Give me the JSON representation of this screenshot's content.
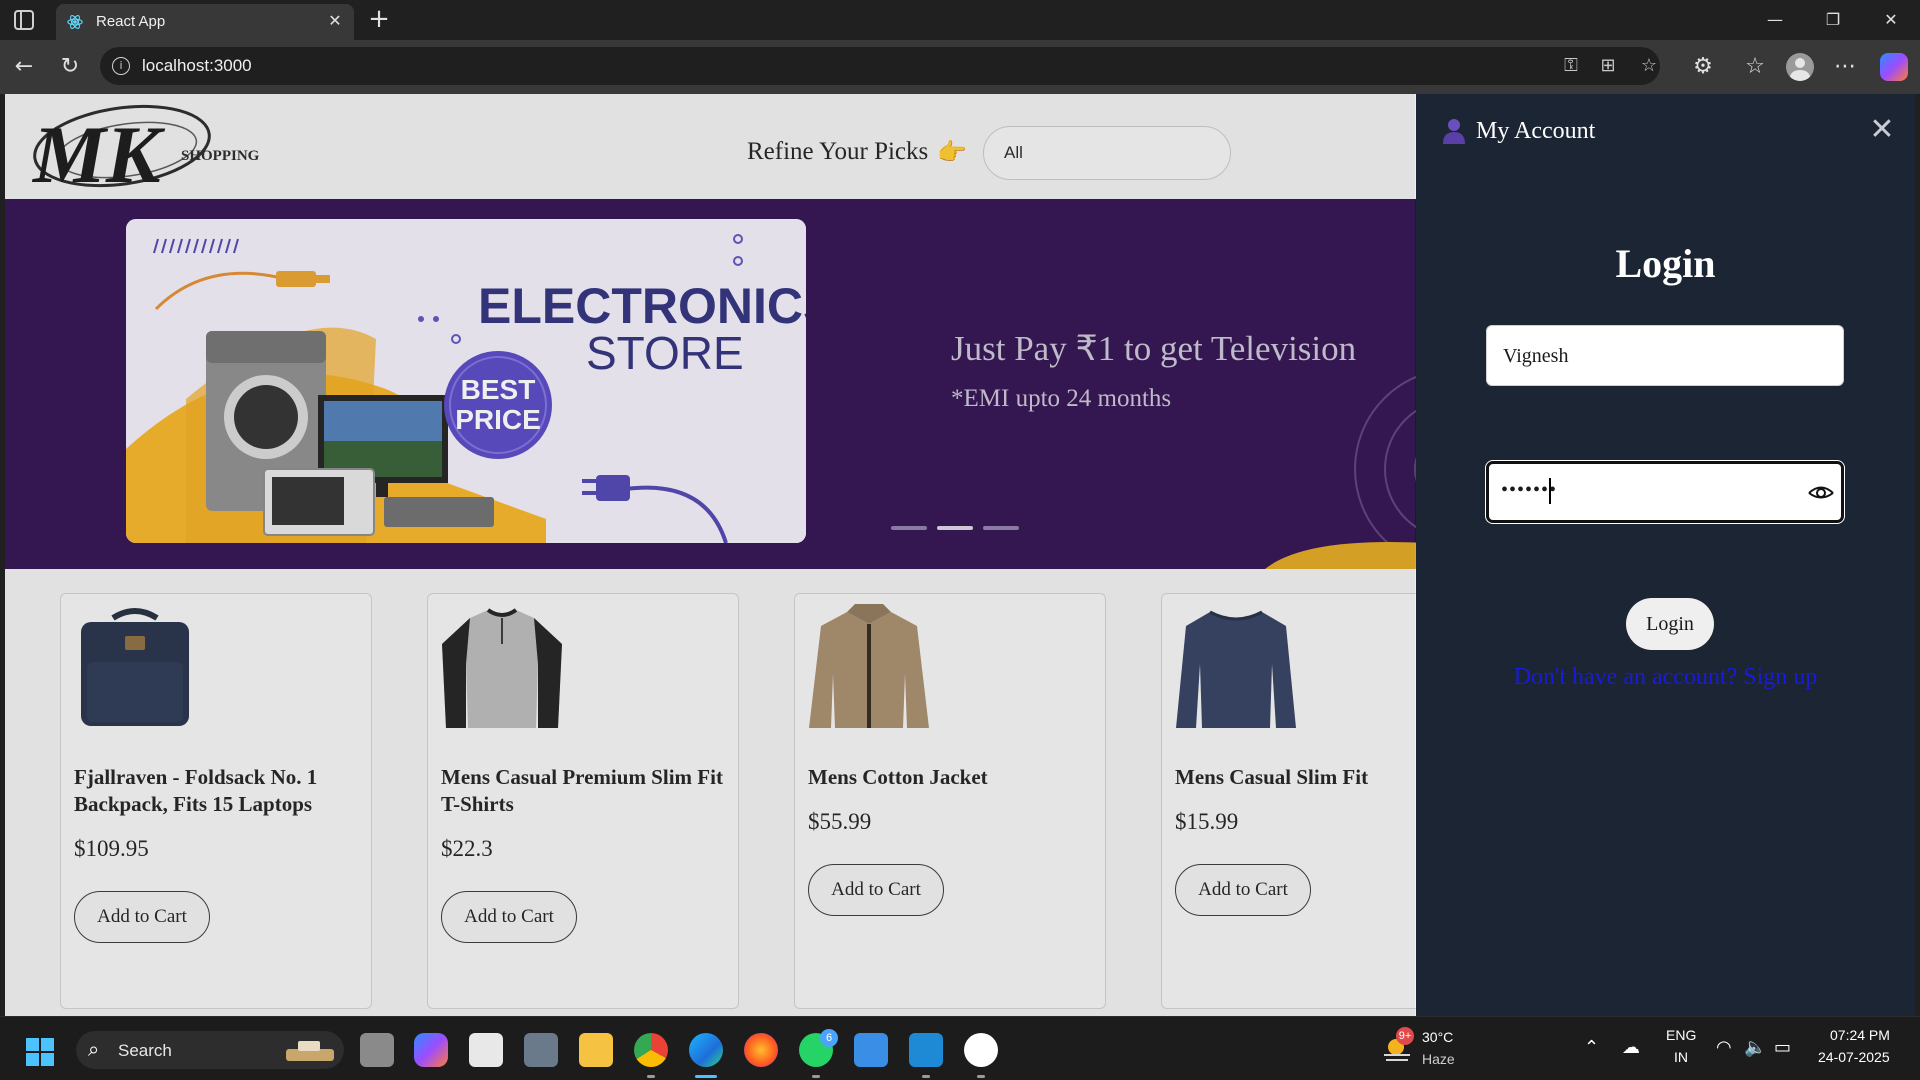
{
  "browser": {
    "tab_title": "React App",
    "url": "localhost:3000"
  },
  "header": {
    "logo_text": "MK",
    "logo_subtext": "SHOPPING",
    "refine_label": "Refine Your Picks",
    "refine_emoji": "👉",
    "filter_value": "All"
  },
  "banner": {
    "image_title_1": "ELECTRONICS",
    "image_title_2": "STORE",
    "badge_1": "BEST",
    "badge_2": "PRICE",
    "headline": "Just Pay ₹1 to get Television",
    "subline": "*EMI upto 24 months",
    "slides": 3,
    "active_slide": 2
  },
  "products": [
    {
      "title": "Fjallraven - Foldsack No. 1 Backpack, Fits 15 Laptops",
      "price": "$109.95",
      "button": "Add to Cart",
      "image": "backpack-image"
    },
    {
      "title": "Mens Casual Premium Slim Fit T-Shirts",
      "price": "$22.3",
      "button": "Add to Cart",
      "image": "tshirt-image"
    },
    {
      "title": "Mens Cotton Jacket",
      "price": "$55.99",
      "button": "Add to Cart",
      "image": "jacket-image"
    },
    {
      "title": "Mens Casual Slim Fit",
      "price": "$15.99",
      "button": "Add to Cart",
      "image": "longsleeve-image"
    }
  ],
  "drawer": {
    "title": "My Account",
    "heading": "Login",
    "username_value": "Vignesh",
    "password_value": "•••••••",
    "login_button": "Login",
    "signup_link": "Don't have an account? Sign up"
  },
  "taskbar": {
    "search_label": "Search",
    "weather_temp": "30°C",
    "weather_condition": "Haze",
    "weather_badge": "9+",
    "whatsapp_badge": "6",
    "lang_1": "ENG",
    "lang_2": "IN",
    "time": "07:24 PM",
    "date": "24-07-2025"
  },
  "colors": {
    "drawer_bg": "#1c2533",
    "banner_bg": "#2b0a4a",
    "link": "#1a1adb",
    "accent": "#4cc2ff"
  }
}
